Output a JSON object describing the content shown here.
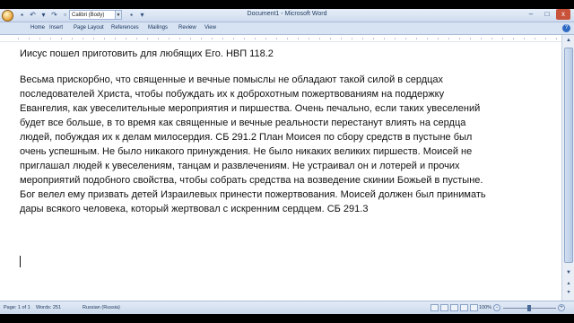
{
  "titlebar": {
    "title": "Document1 - Microsoft Word",
    "font_combo": "Calibri (Body)",
    "close_glyph": "x",
    "min_glyph": "–",
    "max_glyph": "□"
  },
  "tabs": [
    "Home",
    "Insert",
    "Page Layout",
    "References",
    "Mailings",
    "Review",
    "View"
  ],
  "help_glyph": "?",
  "document": {
    "lines": [
      "Иисус пошел приготовить для любящих Его. НВП 118.2",
      "",
      "Весьма прискорбно, что священные и вечные помыслы не обладают такой силой в сердцах",
      "последователей Христа, чтобы побуждать их к доброхотным пожертвованиям  на поддержку",
      "Евангелия, как увеселительные  мероприятия и пиршества.  Очень печально, если таких увеселений",
      "будет все больше, в то время как священные и вечные реальности перестанут влиять  на сердца",
      "людей, побуждая их к делам милосердия. СБ 291.2   План Моисея по сбору средств в пустыне был",
      "очень успешным. Не было никакого принуждения. Не было никаких великих пиршеств. Моисей не",
      "приглашал людей к увеселениям, танцам и развлечениям.  Не устраивал он и лотерей и прочих",
      "мероприятий подобного свойства, чтобы собрать средства на возведение скинии Божьей в пустыне.",
      "Бог велел ему призвать детей Израилевых принести пожертвования. Моисей должен был принимать",
      "дары всякого человека,  который жертвовал с искренним сердцем. СБ 291.3"
    ]
  },
  "statusbar": {
    "page": "Page: 1 of 1",
    "words": "Words: 251",
    "language": "Russian (Russia)",
    "zoom": "100%"
  },
  "colors": {
    "titlebar": "#dbe6f4",
    "close": "#c8523a",
    "text": "#111111"
  }
}
